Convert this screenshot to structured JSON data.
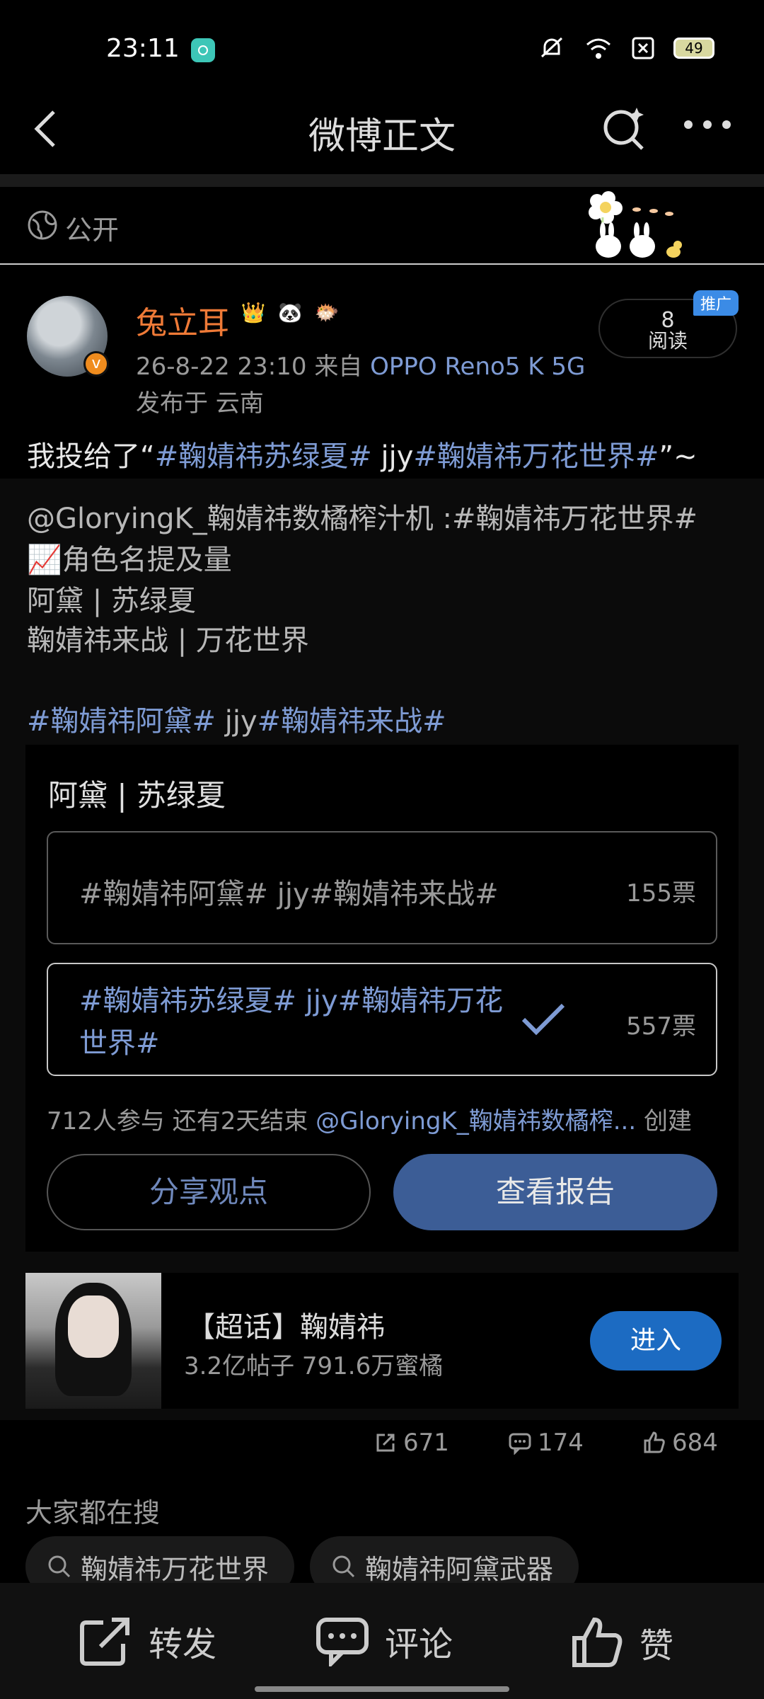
{
  "status_bar": {
    "time": "23:11",
    "battery": "49"
  },
  "nav": {
    "title": "微博正文"
  },
  "visibility": {
    "label": "公开"
  },
  "post": {
    "username": "兔立耳",
    "badges": [
      "👑",
      "🐼",
      "🐡"
    ],
    "timestamp": "26-8-22 23:10",
    "from_label": "来自",
    "device": "OPPO Reno5 K 5G",
    "location": "发布于 云南",
    "read_count": "8",
    "read_label": "阅读",
    "promo": "推广",
    "first_line_prefix": "我投给了“",
    "first_line_tag1": "#鞠婧祎苏绿夏#",
    "first_line_mid": " jjy",
    "first_line_tag2": "#鞠婧祎万花世界#",
    "first_line_suffix": "”~",
    "mention_line": "@GloryingK_鞠婧祎数橘榨汁机 :#鞠婧祎万花世界#",
    "line_chart_emoji": "📈",
    "line_stats": "角色名提及量",
    "line_3": "阿黛 | 苏绿夏",
    "line_4": "鞠婧祎来战 | 万花世界",
    "tags_line_1": "#鞠婧祎阿黛#",
    "tags_line_mid": " jjy",
    "tags_line_2": "#鞠婧祎来战#"
  },
  "poll": {
    "title": "阿黛 | 苏绿夏",
    "options": [
      {
        "text": "#鞠婧祎阿黛# jjy#鞠婧祎来战#",
        "votes": "155票",
        "selected": false
      },
      {
        "text": "#鞠婧祎苏绿夏# jjy#鞠婧祎万花世界#",
        "votes": "557票",
        "selected": true
      }
    ],
    "participants": "712人参与",
    "remaining": "还有2天结束",
    "creator": "@GloryingK_鞠婧祎数橘榨...",
    "created_label": "创建",
    "share_button": "分享观点",
    "report_button": "查看报告"
  },
  "super_topic": {
    "title": "【超话】鞠婧祎",
    "subtitle": "3.2亿帖子 791.6万蜜橘",
    "enter_button": "进入"
  },
  "stats": {
    "reposts": "671",
    "comments": "174",
    "likes": "684"
  },
  "trending": {
    "label": "大家都在搜",
    "chips": [
      "鞠婧祎万花世界",
      "鞠婧祎阿黛武器"
    ]
  },
  "bottom_bar": {
    "repost": "转发",
    "comment": "评论",
    "like": "赞"
  },
  "colors": {
    "link": "#7e9bd4",
    "username": "#ef7a37",
    "report_button": "#3c5d96",
    "enter_button": "#1c6bc2"
  }
}
